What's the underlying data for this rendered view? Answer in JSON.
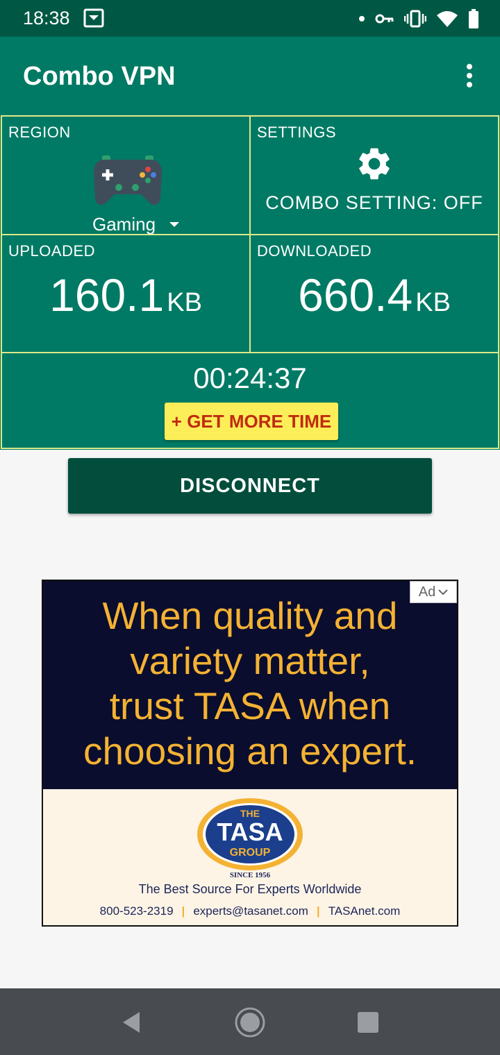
{
  "status_bar": {
    "time": "18:38",
    "icons": [
      "download-notification-icon",
      "dot-icon",
      "vpn-key-icon",
      "vibrate-icon",
      "wifi-icon",
      "battery-icon"
    ]
  },
  "app_bar": {
    "title": "Combo VPN",
    "menu_icon": "more-vert-icon"
  },
  "region": {
    "label": "REGION",
    "value": "Gaming",
    "icon": "gamepad-icon"
  },
  "settings": {
    "label": "SETTINGS",
    "icon": "gear-icon",
    "status": "COMBO SETTING: OFF"
  },
  "uploaded": {
    "label": "UPLOADED",
    "value": "160.1",
    "unit": "KB"
  },
  "downloaded": {
    "label": "DOWNLOADED",
    "value": "660.4",
    "unit": "KB"
  },
  "session": {
    "timer": "00:24:37",
    "more_time_label": "+ GET MORE TIME"
  },
  "disconnect_label": "DISCONNECT",
  "ad": {
    "badge": "Ad",
    "headline": [
      "When quality and",
      "variety matter,",
      "trust TASA when",
      "choosing an expert."
    ],
    "logo_line1": "THE",
    "logo_line2": "TASA",
    "logo_line3": "GROUP",
    "since": "SINCE 1956",
    "tagline": "The Best Source For Experts Worldwide",
    "phone": "800-523-2319",
    "email": "experts@tasanet.com",
    "website": "TASAnet.com"
  },
  "nav": {
    "back": "back-icon",
    "home": "home-icon",
    "recents": "recents-icon"
  },
  "colors": {
    "status_bar": "#005844",
    "primary": "#007a64",
    "grid_border": "#dfe98a",
    "disconnect": "#024d3c",
    "more_time_bg": "#fcee58",
    "more_time_text": "#c02b10",
    "ad_dark": "#0a0d2d",
    "ad_gold": "#f4b233"
  }
}
